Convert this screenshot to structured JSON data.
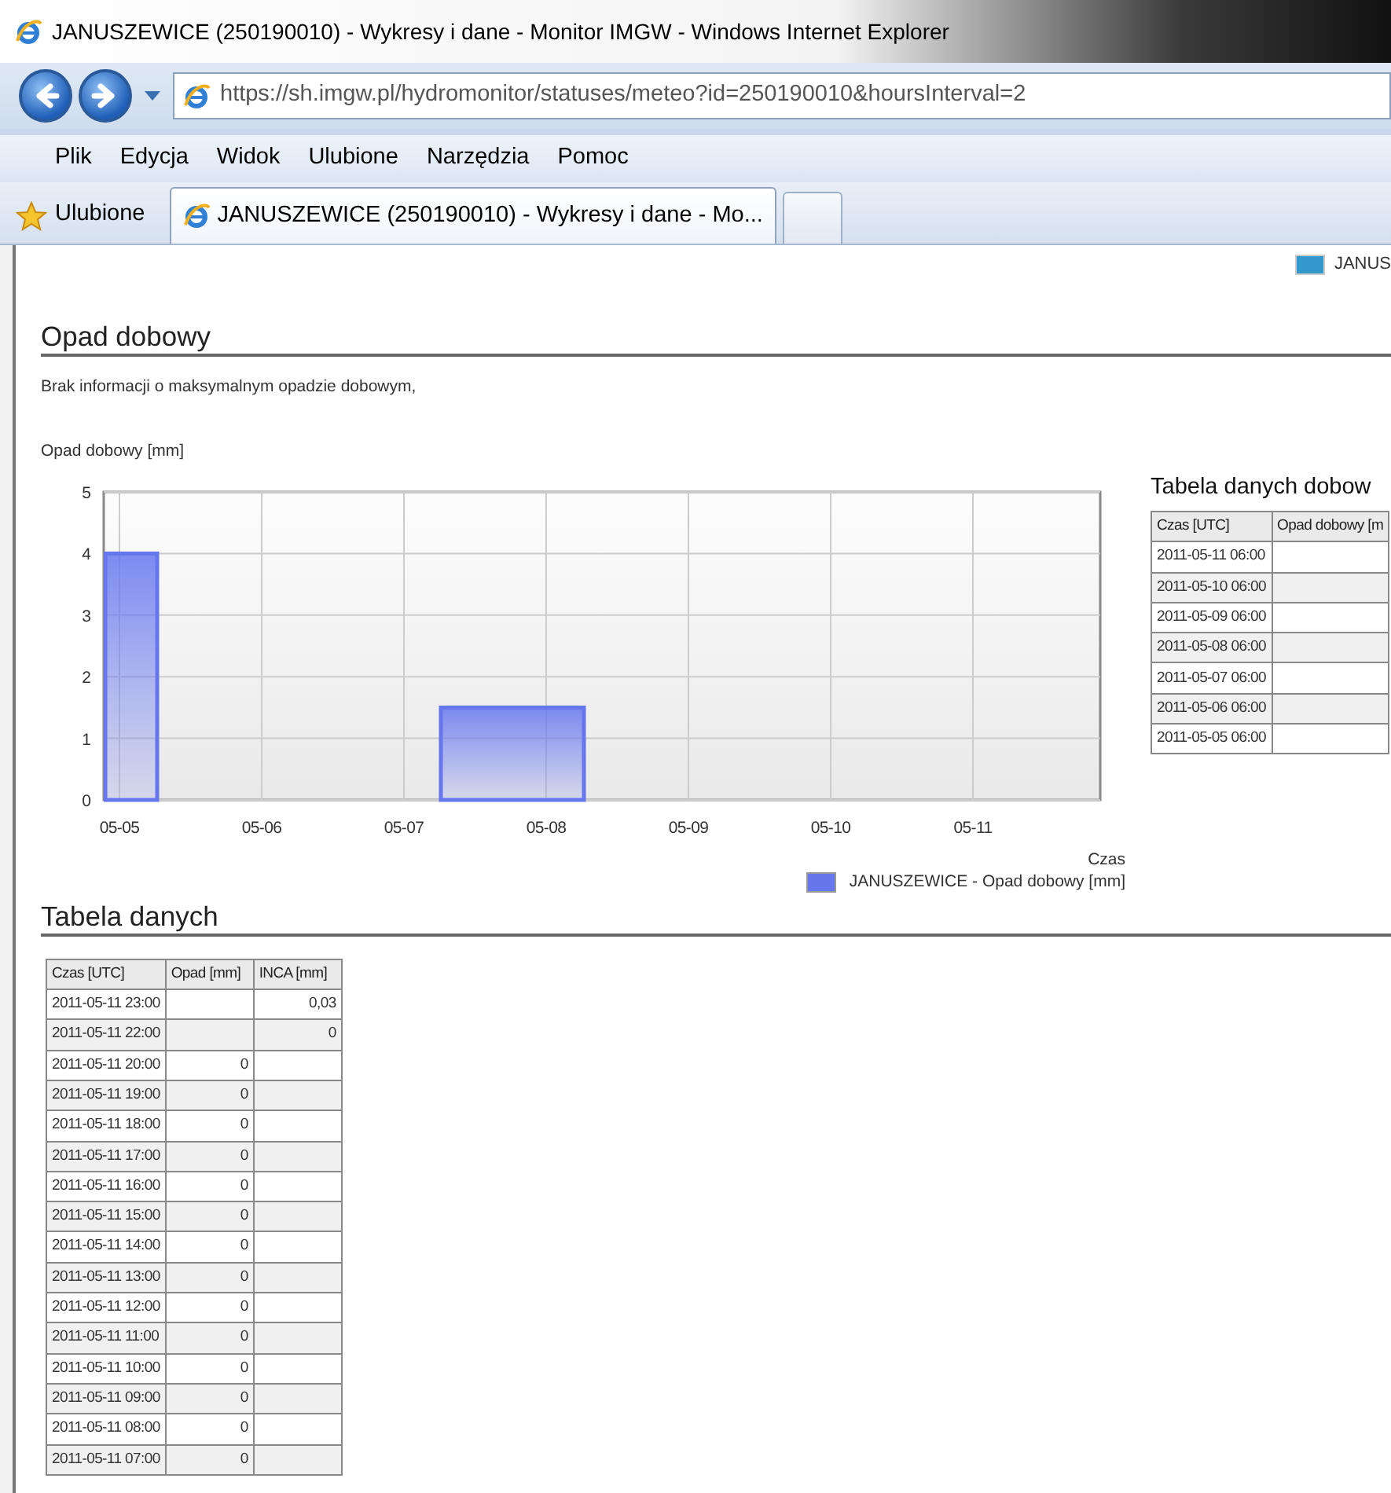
{
  "window": {
    "title": "JANUSZEWICE (250190010) - Wykresy i dane - Monitor IMGW - Windows Internet Explorer"
  },
  "address_bar": {
    "url": "https://sh.imgw.pl/hydromonitor/statuses/meteo?id=250190010&hoursInterval=2"
  },
  "menu": [
    "Plik",
    "Edycja",
    "Widok",
    "Ulubione",
    "Narzędzia",
    "Pomoc"
  ],
  "favorites": {
    "label": "Ulubione"
  },
  "tabs": [
    {
      "label": "JANUSZEWICE (250190010) - Wykresy i dane - Mo...",
      "selected": true
    }
  ],
  "top_legend": {
    "label": "JANUS",
    "color": "#3399cc"
  },
  "daily_section": {
    "title": "Opad dobowy",
    "message": "Brak informacji o maksymalnym opadzie dobowym,",
    "chart_data": {
      "type": "bar",
      "ylabel": "Opad dobowy [mm]",
      "xlabel": "Czas",
      "categories": [
        "05-05",
        "05-06",
        "05-07",
        "05-08",
        "05-09",
        "05-10",
        "05-11"
      ],
      "series": [
        {
          "name": "JANUSZEWICE - Opad dobowy [mm]",
          "color": "#6677ee",
          "values": [
            4,
            0,
            0,
            1.5,
            0,
            0,
            0
          ]
        }
      ],
      "ylim": [
        0,
        5
      ],
      "yticks": [
        0,
        1,
        2,
        3,
        4,
        5
      ],
      "grid": true
    },
    "table": {
      "title": "Tabela danych dobow",
      "columns": [
        "Czas [UTC]",
        "Opad dobowy [m"
      ],
      "rows": [
        {
          "time": "2011-05-11 06:00"
        },
        {
          "time": "2011-05-10 06:00"
        },
        {
          "time": "2011-05-09 06:00"
        },
        {
          "time": "2011-05-08 06:00"
        },
        {
          "time": "2011-05-07 06:00"
        },
        {
          "time": "2011-05-06 06:00"
        },
        {
          "time": "2011-05-05 06:00"
        }
      ]
    }
  },
  "data_table": {
    "title": "Tabela danych",
    "columns": [
      "Czas [UTC]",
      "Opad [mm]",
      "INCA [mm]"
    ],
    "rows": [
      {
        "time": "2011-05-11 23:00",
        "inca": "0,03"
      },
      {
        "time": "2011-05-11 22:00",
        "inca": "0"
      },
      {
        "time": "2011-05-11 20:00",
        "opad": "0"
      },
      {
        "time": "2011-05-11 19:00",
        "opad": "0"
      },
      {
        "time": "2011-05-11 18:00",
        "opad": "0"
      },
      {
        "time": "2011-05-11 17:00",
        "opad": "0"
      },
      {
        "time": "2011-05-11 16:00",
        "opad": "0"
      },
      {
        "time": "2011-05-11 15:00",
        "opad": "0"
      },
      {
        "time": "2011-05-11 14:00",
        "opad": "0"
      },
      {
        "time": "2011-05-11 13:00",
        "opad": "0"
      },
      {
        "time": "2011-05-11 12:00",
        "opad": "0"
      },
      {
        "time": "2011-05-11 11:00",
        "opad": "0"
      },
      {
        "time": "2011-05-11 10:00",
        "opad": "0"
      },
      {
        "time": "2011-05-11 09:00",
        "opad": "0"
      },
      {
        "time": "2011-05-11 08:00",
        "opad": "0"
      },
      {
        "time": "2011-05-11 07:00",
        "opad": "0"
      }
    ]
  }
}
